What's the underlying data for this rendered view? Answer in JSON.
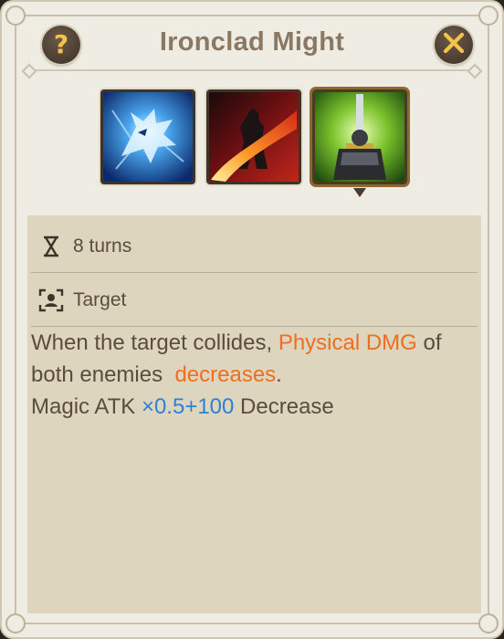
{
  "popup": {
    "title": "Ironclad Might",
    "help_label": "?",
    "close_icon": "close-icon"
  },
  "skills": [
    {
      "icon": "frost-wolf-skill-icon",
      "selected": false
    },
    {
      "icon": "fire-strike-skill-icon",
      "selected": false
    },
    {
      "icon": "armored-knight-sword-skill-icon",
      "selected": true
    }
  ],
  "info": {
    "duration_icon": "hourglass-icon",
    "duration": "8 turns",
    "target_icon": "target-person-icon",
    "target": "Target"
  },
  "description": {
    "line1_part1": "When the target collides, ",
    "line1_highlight": "Physical DMG",
    "line1_part2": "  of",
    "line2_part1": "both enemies  ",
    "line2_highlight": "decreases",
    "line2_part2": ".",
    "line3_part1": "Magic ATK ",
    "line3_highlight": "×0.5+100",
    "line3_part2": " Decrease"
  },
  "colors": {
    "highlight_orange": "#ee6e22",
    "highlight_blue": "#2f7fd6",
    "icon_gold": "#f5c34a"
  }
}
